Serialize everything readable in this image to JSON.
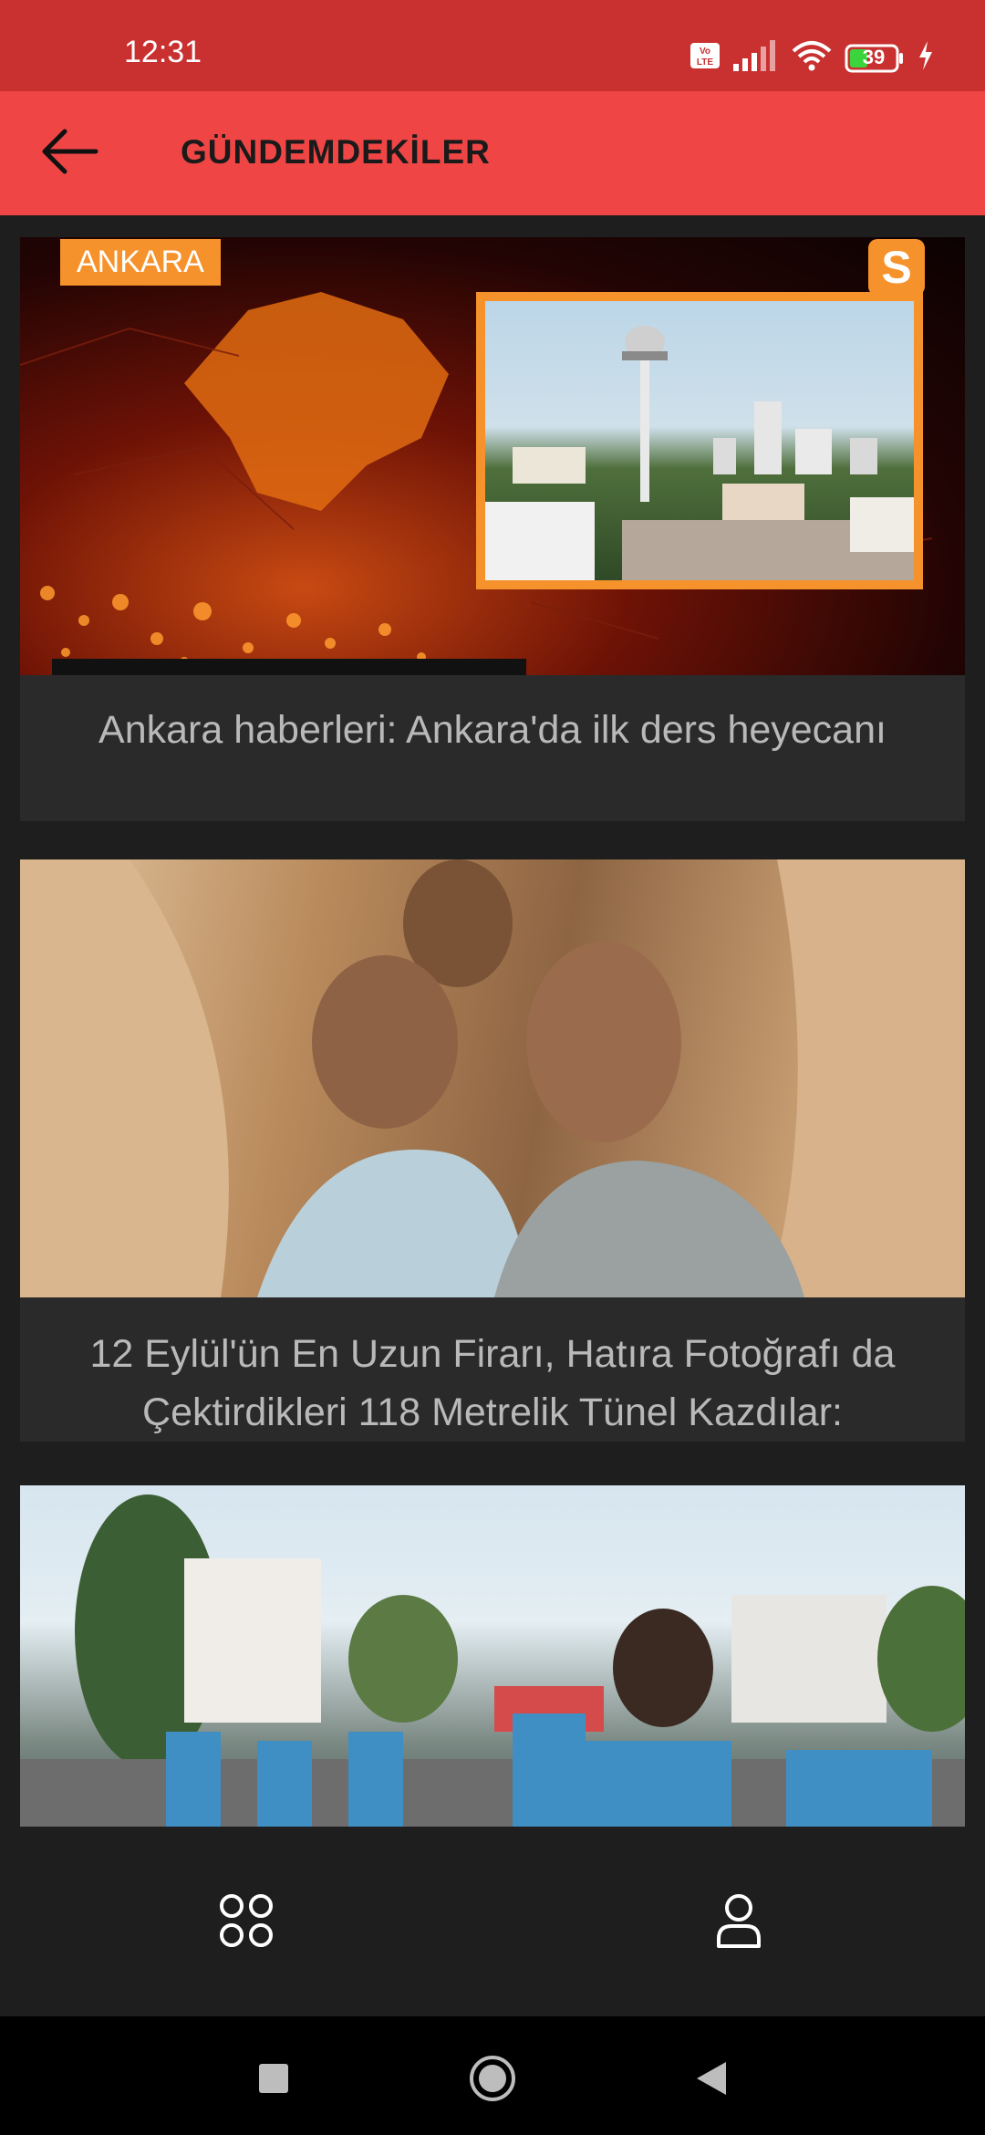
{
  "status": {
    "time": "12:31",
    "battery": "39",
    "volte_label": "Vo LTE"
  },
  "header": {
    "title": "GÜNDEMDEKİLER"
  },
  "feed": {
    "items": [
      {
        "tag": "ANKARA",
        "badge": "S",
        "title": "Ankara haberleri: Ankara'da ilk ders heyecanı"
      },
      {
        "title": "12 Eylül'ün En Uzun Firarı, Hatıra Fotoğrafı da Çektirdikleri 118 Metrelik Tünel Kazdılar: 'Arkadaşımız Bir Şiş Soktu; Hava"
      },
      {
        "title": ""
      }
    ]
  },
  "nav": {
    "items": [
      {
        "icon": "grid-icon"
      },
      {
        "icon": "profile-icon"
      }
    ]
  },
  "colors": {
    "status_bar": "#c93030",
    "app_bar": "#f04545",
    "background": "#1e1e1e",
    "card": "#2a2a2a",
    "accent_orange": "#f6922b"
  }
}
